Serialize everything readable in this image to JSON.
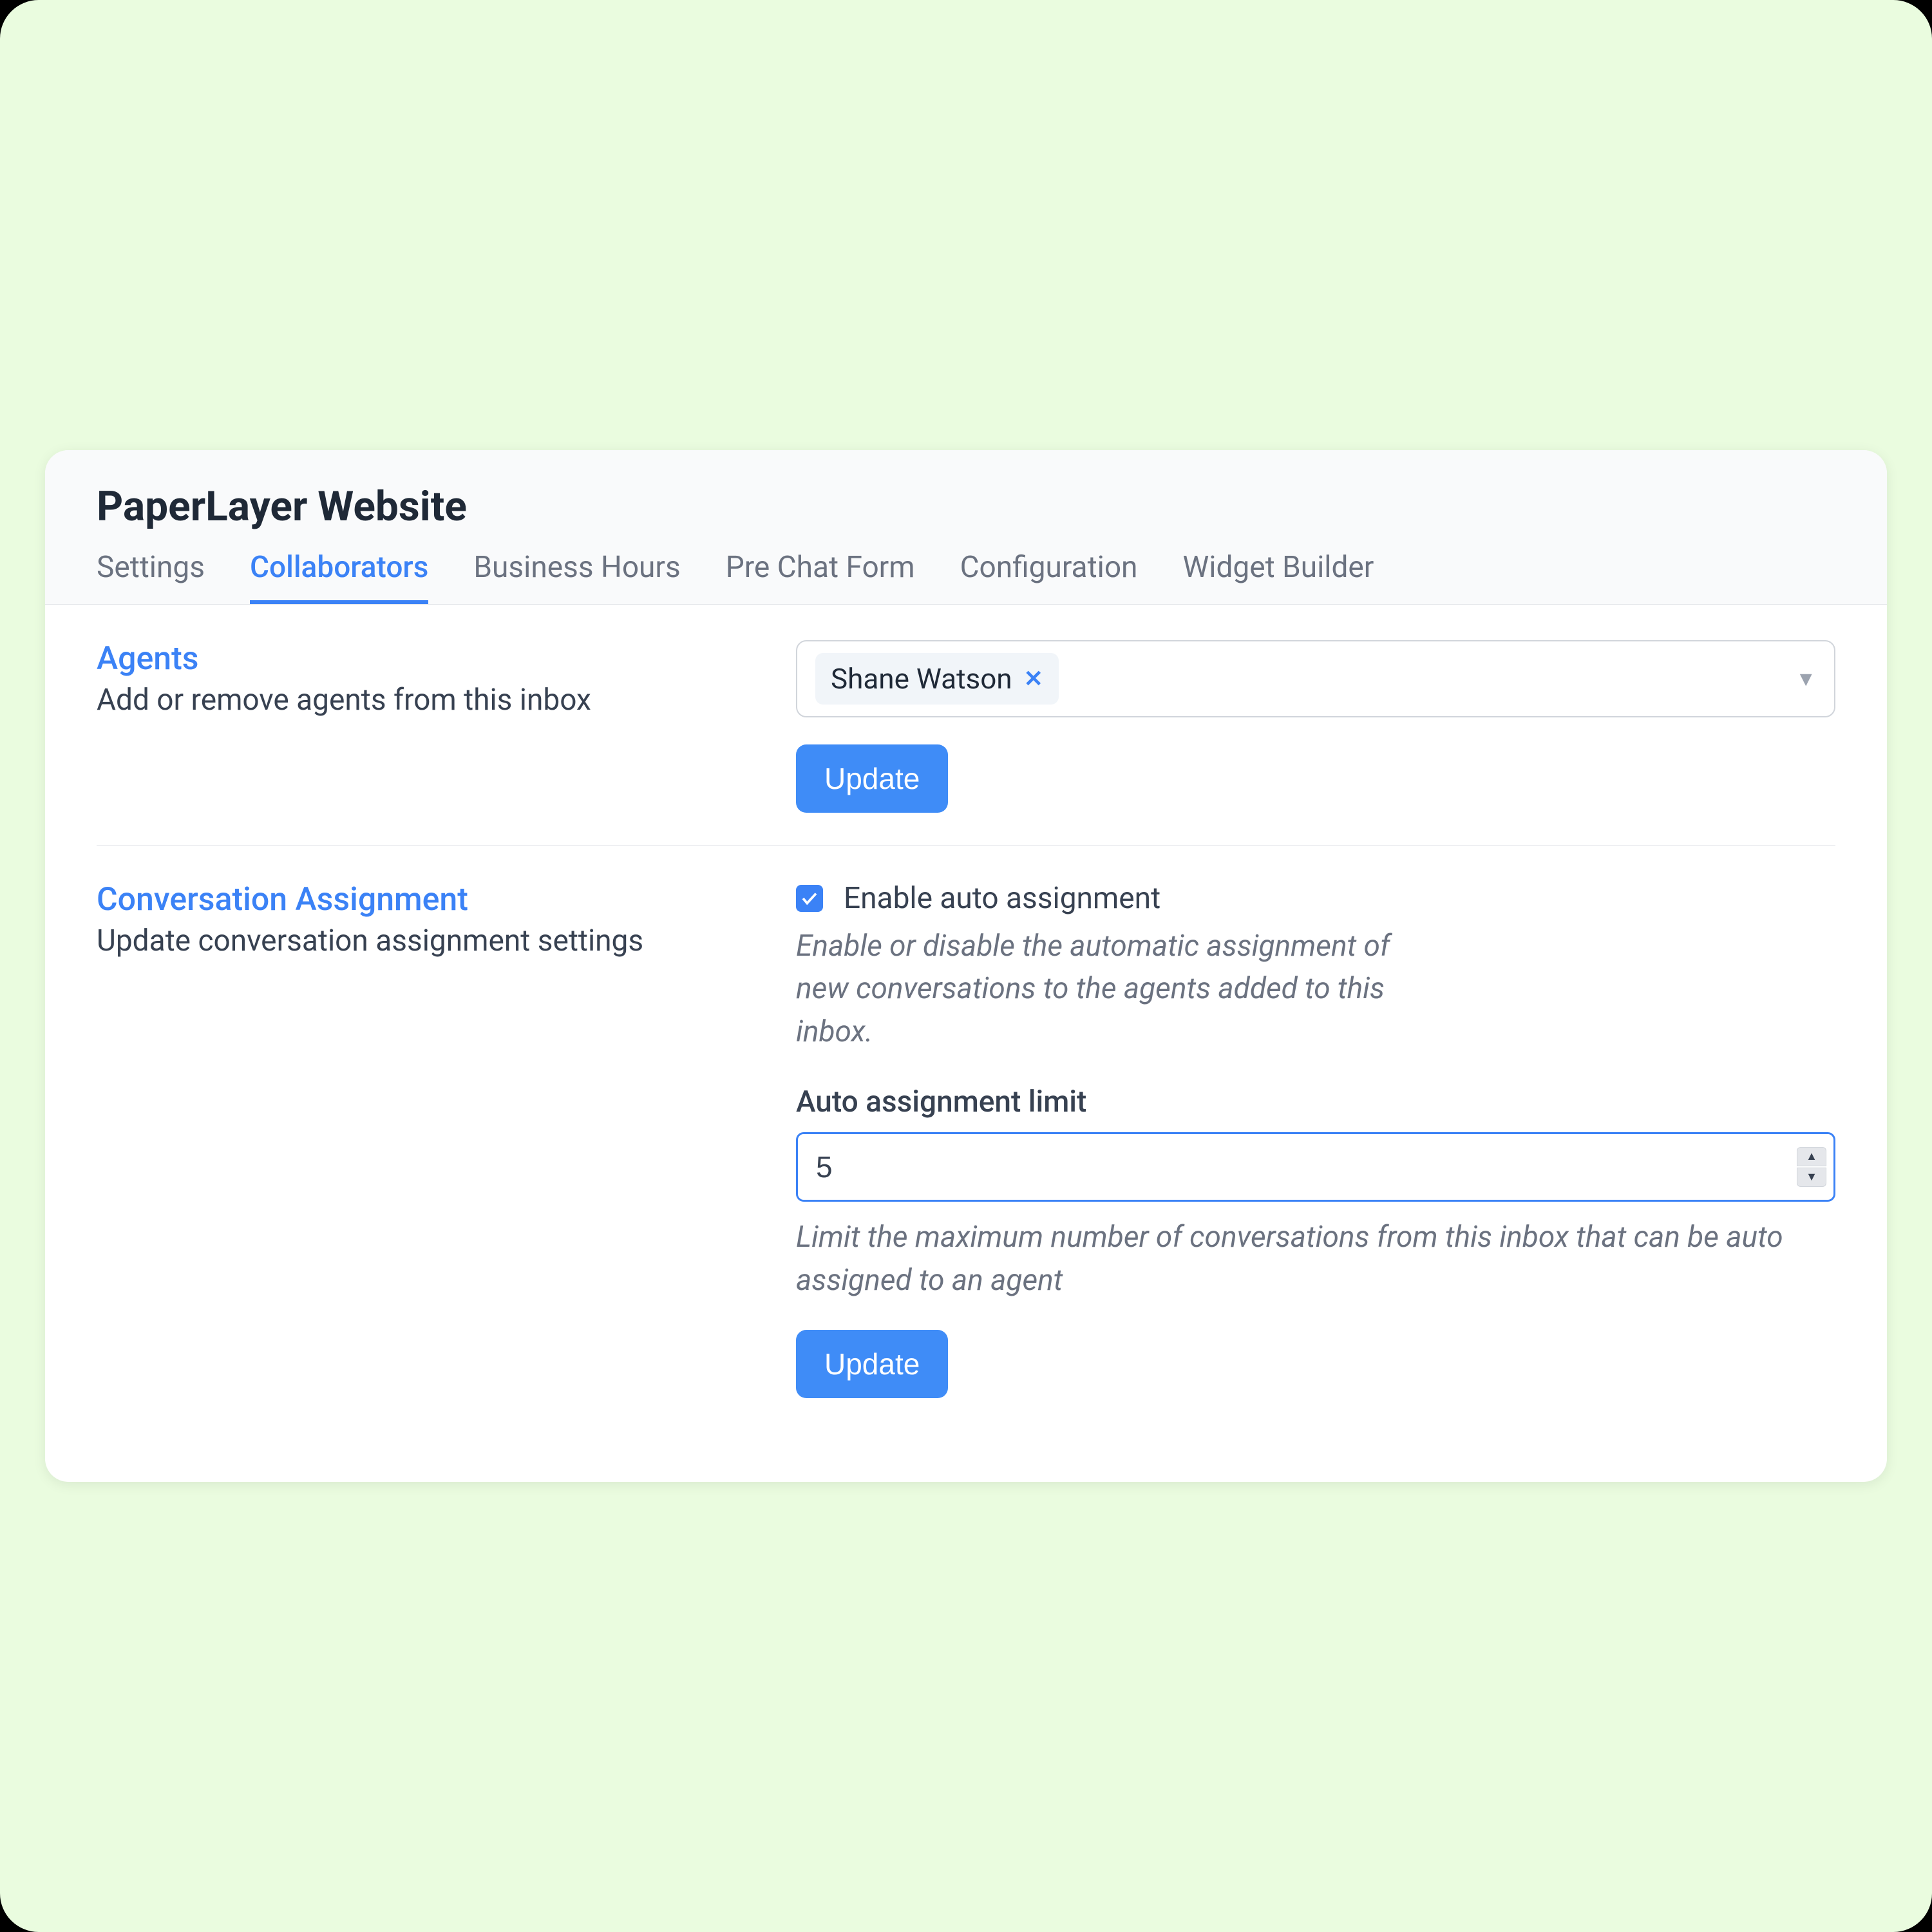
{
  "page_title": "PaperLayer Website",
  "tabs": [
    {
      "label": "Settings",
      "active": false
    },
    {
      "label": "Collaborators",
      "active": true
    },
    {
      "label": "Business Hours",
      "active": false
    },
    {
      "label": "Pre Chat Form",
      "active": false
    },
    {
      "label": "Configuration",
      "active": false
    },
    {
      "label": "Widget Builder",
      "active": false
    }
  ],
  "agents_section": {
    "title": "Agents",
    "subtitle": "Add or remove agents from this inbox",
    "selected_agents": [
      "Shane Watson"
    ],
    "update_button": "Update"
  },
  "assignment_section": {
    "title": "Conversation Assignment",
    "subtitle": "Update conversation assignment settings",
    "enable_checkbox_label": "Enable auto assignment",
    "enable_checkbox_checked": true,
    "enable_help_text": "Enable or disable the automatic assignment of new conversations to the agents added to this inbox.",
    "limit_label": "Auto assignment limit",
    "limit_value": "5",
    "limit_help_text": "Limit the maximum number of conversations from this inbox that can be auto assigned to an agent",
    "update_button": "Update"
  },
  "colors": {
    "primary": "#3b82f6",
    "background": "#eafcdf"
  }
}
